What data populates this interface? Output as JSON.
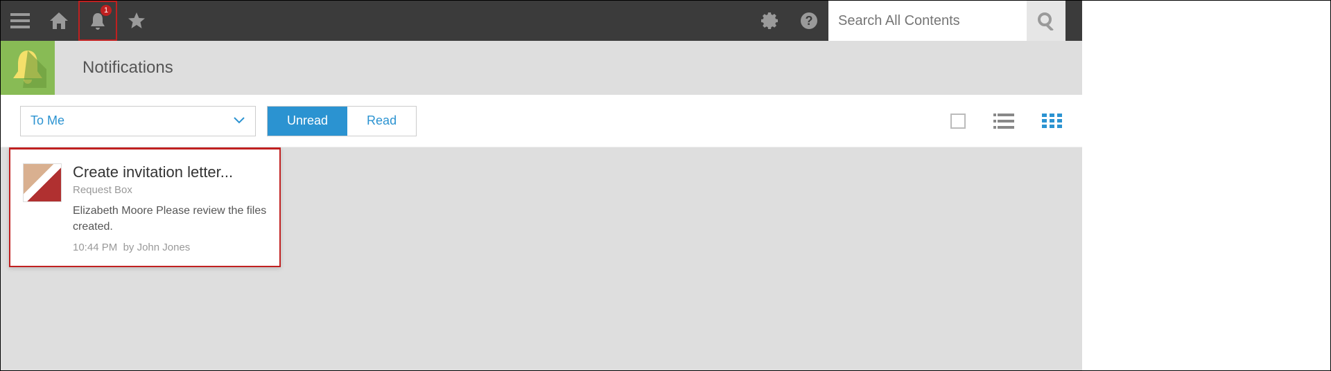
{
  "topbar": {
    "notification_badge": "1",
    "search_placeholder": "Search All Contents"
  },
  "page": {
    "title": "Notifications"
  },
  "filter": {
    "dropdown_label": "To Me",
    "tabs": {
      "unread": "Unread",
      "read": "Read"
    }
  },
  "cards": [
    {
      "title": "Create invitation letter...",
      "subtitle": "Request Box",
      "message": "Elizabeth Moore Please review the files created.",
      "time": "10:44 PM",
      "by_prefix": "by",
      "author": "John Jones"
    }
  ]
}
